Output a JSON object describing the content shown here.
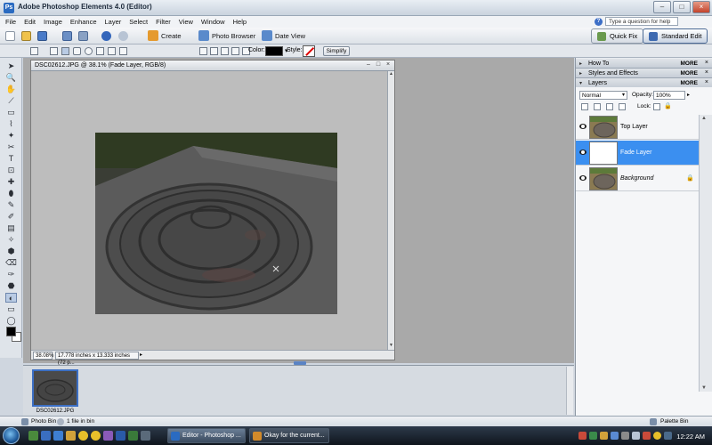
{
  "app": {
    "title": "Adobe Photoshop Elements 4.0 (Editor)",
    "window_buttons": [
      "–",
      "□",
      "×"
    ]
  },
  "menu": [
    "File",
    "Edit",
    "Image",
    "Enhance",
    "Layer",
    "Select",
    "Filter",
    "View",
    "Window",
    "Help"
  ],
  "help": {
    "placeholder": "Type a question for help"
  },
  "shortcuts": {
    "create": "Create",
    "photo_browser": "Photo Browser",
    "date_view": "Date View",
    "quick_fix": "Quick Fix",
    "standard_edit": "Standard Edit"
  },
  "options": {
    "color_label": "Color:",
    "style_label": "Style:",
    "simplify": "Simplify",
    "foreground_color": "#000000"
  },
  "document": {
    "title": "DSC02612.JPG @ 38.1% (Fade Layer, RGB/8)",
    "zoom": "38.08%",
    "size_info": "17.778 inches x 13.333 inches (72 p...",
    "status_arrow": "▸",
    "doc_buttons": [
      "–",
      "□",
      "×"
    ]
  },
  "palettes": {
    "how_to": "How To",
    "styles": "Styles and Effects",
    "layers": "Layers",
    "more": "MORE",
    "close": "×",
    "collapsed_arrow": "▸",
    "expanded_arrow": "▾"
  },
  "layers_panel": {
    "blend_mode": "Normal",
    "opacity_label": "Opacity:",
    "opacity": "100%",
    "opacity_arrow": "▸",
    "lock_label": "Lock:",
    "lock_glyph": "🔒",
    "layers": [
      {
        "name": "Top Layer",
        "selected": false,
        "italic": false,
        "locked": false
      },
      {
        "name": "Fade Layer",
        "selected": true,
        "italic": false,
        "locked": false
      },
      {
        "name": "Background",
        "selected": false,
        "italic": true,
        "locked": true
      }
    ]
  },
  "photo_bin": {
    "thumb_caption": "DSC02612.JPG"
  },
  "bin_bar": {
    "photo_bin": "Photo Bin",
    "files": "1 file in bin",
    "palette_bin": "Palette Bin"
  },
  "taskbar": {
    "tasks": [
      "Editor - Photoshop ...",
      "Okay for the current..."
    ],
    "clock": "12:22 AM"
  },
  "icons": {
    "color_picker": "▾",
    "tools": [
      "➤",
      "🔍",
      "✋",
      "⟋",
      "▭",
      "⌇",
      "✦",
      "✂",
      "T",
      "⊡",
      "✚",
      "⬮",
      "✎",
      "✐",
      "▤",
      "✧",
      "⬢",
      "⌫",
      "✑",
      "⬣",
      "◐",
      "▭",
      "◯",
      "⚈",
      "◓"
    ]
  }
}
